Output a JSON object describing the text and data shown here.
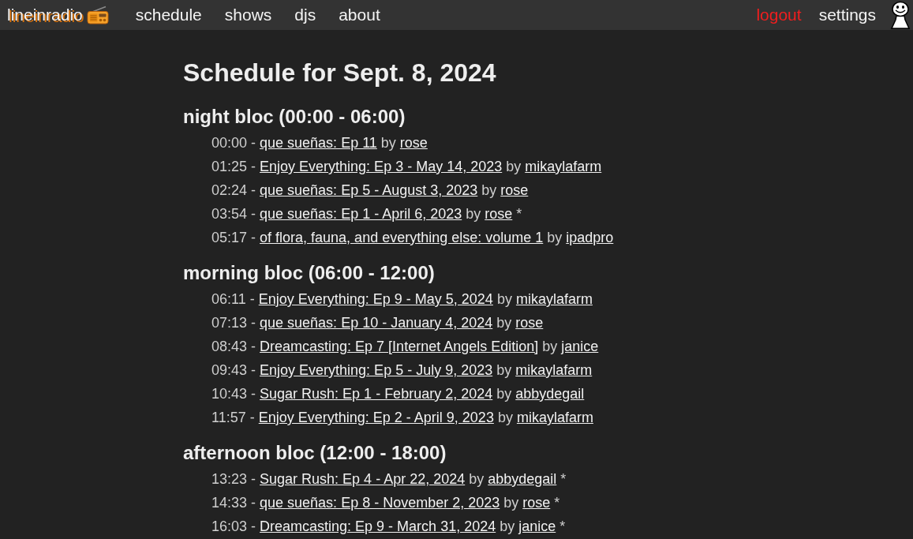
{
  "nav": {
    "logo": "lineinradio",
    "links": [
      {
        "label": "schedule"
      },
      {
        "label": "shows"
      },
      {
        "label": "djs"
      },
      {
        "label": "about"
      }
    ],
    "account_links": [
      {
        "label": "logout",
        "kind": "alert"
      },
      {
        "label": "settings",
        "kind": "plain"
      }
    ]
  },
  "page": {
    "title": "Schedule for Sept. 8, 2024"
  },
  "blocs": [
    {
      "title": "night bloc (00:00 - 06:00)",
      "entries": [
        {
          "time": "00:00",
          "dash": "-",
          "show": "que sueñas: Ep 11",
          "by": "by",
          "dj": "rose"
        },
        {
          "time": "01:25",
          "dash": "-",
          "show": "Enjoy Everything: Ep 3 - May 14, 2023",
          "by": "by",
          "dj": "mikaylafarm"
        },
        {
          "time": "02:24",
          "dash": "-",
          "show": "que sueñas: Ep 5 - August 3, 2023",
          "by": "by",
          "dj": "rose"
        },
        {
          "time": "03:54",
          "dash": "-",
          "show": "que sueñas: Ep 1 - April 6, 2023",
          "by": "by",
          "dj": "rose",
          "note": "*"
        },
        {
          "time": "05:17",
          "dash": "-",
          "show": "of flora, fauna, and everything else: volume 1",
          "by": "by",
          "dj": "ipadpro"
        }
      ]
    },
    {
      "title": "morning bloc (06:00 - 12:00)",
      "entries": [
        {
          "time": "06:11",
          "dash": "-",
          "show": "Enjoy Everything: Ep 9 - May 5, 2024",
          "by": "by",
          "dj": "mikaylafarm"
        },
        {
          "time": "07:13",
          "dash": "-",
          "show": "que sueñas: Ep 10 - January 4, 2024",
          "by": "by",
          "dj": "rose"
        },
        {
          "time": "08:43",
          "dash": "-",
          "show": "Dreamcasting: Ep 7 [Internet Angels Edition]",
          "by": "by",
          "dj": "janice"
        },
        {
          "time": "09:43",
          "dash": "-",
          "show": "Enjoy Everything: Ep 5 - July 9, 2023",
          "by": "by",
          "dj": "mikaylafarm"
        },
        {
          "time": "10:43",
          "dash": "-",
          "show": "Sugar Rush: Ep 1 - February 2, 2024",
          "by": "by",
          "dj": "abbydegail"
        },
        {
          "time": "11:57",
          "dash": "-",
          "show": "Enjoy Everything: Ep 2 - April 9, 2023",
          "by": "by",
          "dj": "mikaylafarm"
        }
      ]
    },
    {
      "title": "afternoon bloc (12:00 - 18:00)",
      "entries": [
        {
          "time": "13:23",
          "dash": "-",
          "show": "Sugar Rush: Ep 4 - Apr 22, 2024",
          "by": "by",
          "dj": "abbydegail",
          "note": "*"
        },
        {
          "time": "14:33",
          "dash": "-",
          "show": "que sueñas: Ep 8 - November 2, 2023",
          "by": "by",
          "dj": "rose",
          "note": "*"
        },
        {
          "time": "16:03",
          "dash": "-",
          "show": "Dreamcasting: Ep 9 - March 31, 2024",
          "by": "by",
          "dj": "janice",
          "note": "*"
        }
      ]
    }
  ]
}
